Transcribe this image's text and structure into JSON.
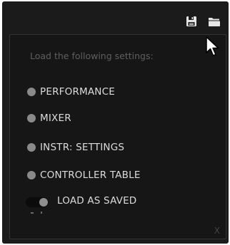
{
  "toolbar": {
    "save_icon": "save-disk-icon",
    "open_icon": "folder-open-icon"
  },
  "dialog": {
    "heading": "Load the following settings:",
    "options": [
      {
        "label": "PERFORMANCE"
      },
      {
        "label": "MIXER"
      },
      {
        "label": "INSTR: SETTINGS"
      },
      {
        "label": "CONTROLLER TABLE"
      }
    ],
    "toggle": {
      "label": "LOAD AS SAVED",
      "state": "on"
    },
    "close_label": "X"
  },
  "colors": {
    "panel_bg": "#1b1b1b",
    "text": "#dcdcdc",
    "muted_text": "#5f5f5f",
    "dot": "#8a8a8a"
  }
}
